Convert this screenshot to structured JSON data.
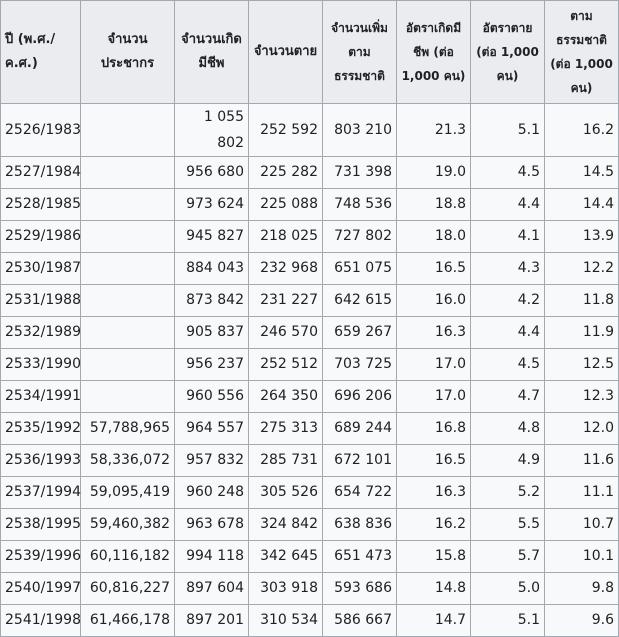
{
  "headers": [
    "ปี (พ.ศ./ ค.ศ.)",
    "จำนวนประชากร",
    "จำนวนเกิดมีชีพ",
    "จำนวนตาย",
    "จำนวนเพิ่มตามธรรมชาติ",
    "อัตราเกิดมีชีพ (ต่อ 1,000 คน)",
    "อัตราตาย (ต่อ 1,000 คน)",
    "ตามธรรมชาติ (ต่อ 1,000 คน)"
  ],
  "rows": [
    [
      "2526/1983",
      "",
      "1 055 802",
      "252 592",
      "803 210",
      "21.3",
      "5.1",
      "16.2"
    ],
    [
      "2527/1984",
      "",
      "956 680",
      "225 282",
      "731 398",
      "19.0",
      "4.5",
      "14.5"
    ],
    [
      "2528/1985",
      "",
      "973 624",
      "225 088",
      "748 536",
      "18.8",
      "4.4",
      "14.4"
    ],
    [
      "2529/1986",
      "",
      "945 827",
      "218 025",
      "727 802",
      "18.0",
      "4.1",
      "13.9"
    ],
    [
      "2530/1987",
      "",
      "884 043",
      "232 968",
      "651 075",
      "16.5",
      "4.3",
      "12.2"
    ],
    [
      "2531/1988",
      "",
      "873 842",
      "231 227",
      "642 615",
      "16.0",
      "4.2",
      "11.8"
    ],
    [
      "2532/1989",
      "",
      "905 837",
      "246 570",
      "659 267",
      "16.3",
      "4.4",
      "11.9"
    ],
    [
      "2533/1990",
      "",
      "956 237",
      "252 512",
      "703 725",
      "17.0",
      "4.5",
      "12.5"
    ],
    [
      "2534/1991",
      "",
      "960 556",
      "264 350",
      "696 206",
      "17.0",
      "4.7",
      "12.3"
    ],
    [
      "2535/1992",
      "57,788,965",
      "964 557",
      "275 313",
      "689 244",
      "16.8",
      "4.8",
      "12.0"
    ],
    [
      "2536/1993",
      "58,336,072",
      "957 832",
      "285 731",
      "672 101",
      "16.5",
      "4.9",
      "11.6"
    ],
    [
      "2537/1994",
      "59,095,419",
      "960 248",
      "305 526",
      "654 722",
      "16.3",
      "5.2",
      "11.1"
    ],
    [
      "2538/1995",
      "59,460,382",
      "963 678",
      "324 842",
      "638 836",
      "16.2",
      "5.5",
      "10.7"
    ],
    [
      "2539/1996",
      "60,116,182",
      "994 118",
      "342 645",
      "651 473",
      "15.8",
      "5.7",
      "10.1"
    ],
    [
      "2540/1997",
      "60,816,227",
      "897 604",
      "303 918",
      "593 686",
      "14.8",
      "5.0",
      "9.8"
    ],
    [
      "2541/1998",
      "61,466,178",
      "897 201",
      "310 534",
      "586 667",
      "14.7",
      "5.1",
      "9.6"
    ]
  ]
}
